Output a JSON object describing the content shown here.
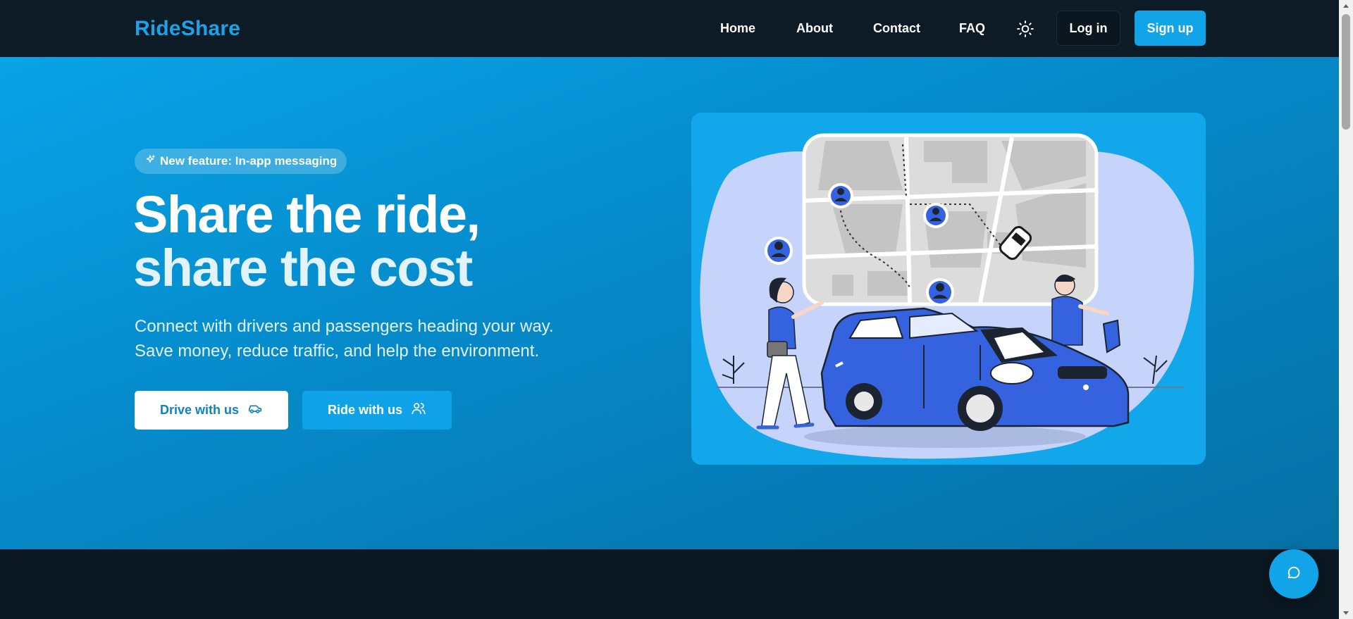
{
  "nav": {
    "brand": "RideShare",
    "links": [
      "Home",
      "About",
      "Contact",
      "FAQ"
    ],
    "theme_icon": "sun-icon",
    "login_label": "Log in",
    "signup_label": "Sign up"
  },
  "hero": {
    "badge_icon": "sparkle-icon",
    "badge_label": "New feature: In-app messaging",
    "title_line1": "Share the ride,",
    "title_line2": "share the cost",
    "subtitle": "Connect with drivers and passengers heading your way. Save money, reduce traffic, and help the environment.",
    "drive_button_label": "Drive with us",
    "drive_button_icon": "car-icon",
    "ride_button_label": "Ride with us",
    "ride_button_icon": "users-icon",
    "illustration": "rideshare-illustration"
  },
  "chat": {
    "icon": "chat-bubble-icon"
  },
  "colors": {
    "accent": "#12a4e9",
    "nav_bg": "#0c1b25",
    "hero_start": "#08a3e6",
    "hero_end": "#0670a5",
    "car_blue": "#3563e0"
  }
}
